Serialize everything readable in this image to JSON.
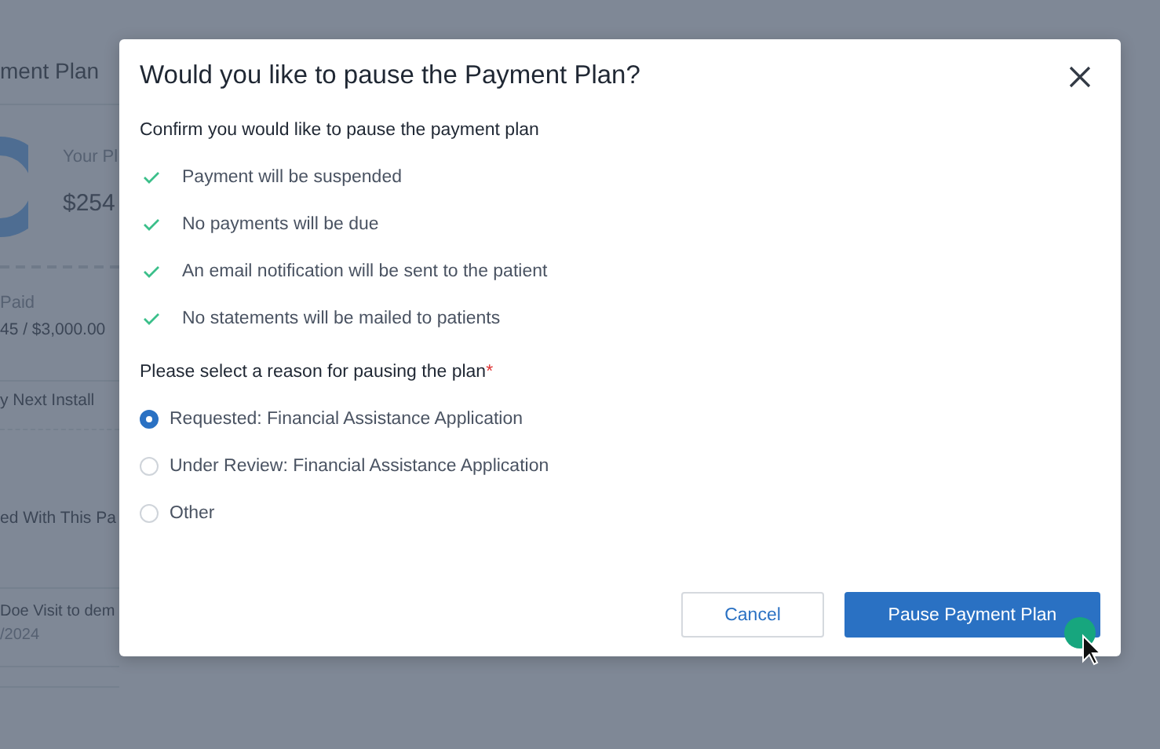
{
  "background_page": {
    "title": "ment Plan",
    "plan_label": "Your Pl",
    "plan_amount": "$254",
    "paid_label": "Paid",
    "paid_value": "45 / $3,000.00",
    "next_installment": "y Next Install",
    "associated_heading": "ed With This Pa",
    "visit": {
      "name": "Doe Visit to dem",
      "date": "/2024"
    }
  },
  "dialog": {
    "title": "Would you like to pause the Payment Plan?",
    "intro": "Confirm you would like to pause the payment plan",
    "consequences": [
      "Payment will be suspended",
      "No payments will be due",
      "An email notification will be sent to the patient",
      "No statements will be mailed to patients"
    ],
    "reason_label": "Please select a reason for pausing the plan",
    "required_mark": "*",
    "reasons": [
      {
        "label": "Requested: Financial Assistance Application",
        "selected": true
      },
      {
        "label": "Under Review: Financial Assistance Application",
        "selected": false
      },
      {
        "label": "Other",
        "selected": false
      }
    ],
    "buttons": [
      {
        "label": "Cancel",
        "kind": "secondary"
      },
      {
        "label": "Pause Payment Plan",
        "kind": "primary"
      }
    ]
  }
}
